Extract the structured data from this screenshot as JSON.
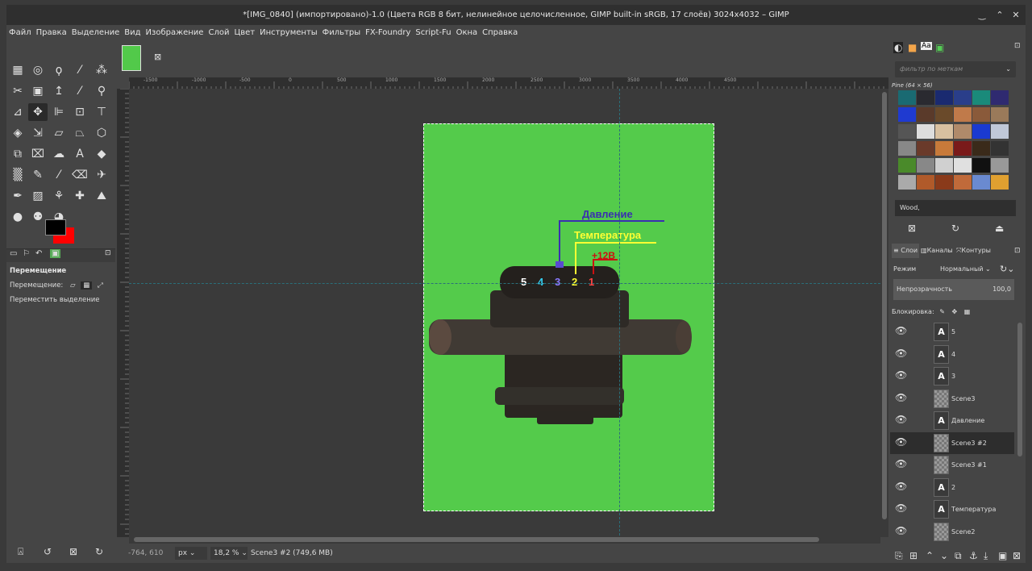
{
  "window": {
    "title": "*[IMG_0840] (импортировано)-1.0 (Цвета RGB 8 бит, нелинейное целочисленное, GIMP built-in sRGB, 17 слоёв) 3024x4032 – GIMP"
  },
  "menu": [
    "Файл",
    "Правка",
    "Выделение",
    "Вид",
    "Изображение",
    "Слой",
    "Цвет",
    "Инструменты",
    "Фильтры",
    "FX-Foundry",
    "Script-Fu",
    "Окна",
    "Справка"
  ],
  "hruler": {
    "ticks": [
      "-1500",
      "-1000",
      "-500",
      "0",
      "500",
      "1000",
      "1500",
      "2000",
      "2500",
      "3000",
      "3500",
      "4000",
      "4500"
    ]
  },
  "vruler": {
    "ticks": [
      "-1500",
      "-1000",
      "-500",
      "0",
      "500",
      "1000",
      "1500",
      "2000",
      "2500",
      "3000",
      "3500",
      "4000",
      "4500"
    ]
  },
  "tool_options": {
    "title": "Перемещение",
    "move_label": "Перемещение:",
    "option_label": "Переместить выделение"
  },
  "status": {
    "coords": "-764, 610",
    "unit": "px",
    "zoom": "18,2 %",
    "info": "Scene3 #2 (749,6 MB)"
  },
  "colors": {
    "foreground": "#000000",
    "background": "#ff0000",
    "image_bg": "#54cb4b"
  },
  "canvas_labels": {
    "pressure": "Давление",
    "temperature": "Температура",
    "power": "+12В",
    "pin5": "5",
    "pin4": "4",
    "pin3": "3",
    "pin2": "2",
    "pin1": "1"
  },
  "patterns": {
    "filter_placeholder": "фильтр по меткам",
    "set_label": "Pine (64 × 56)",
    "selected": "Wood,"
  },
  "layers_panel": {
    "tabs": [
      "Слои",
      "Каналы",
      "Контуры"
    ],
    "mode_label": "Режим",
    "mode_value": "Нормальный",
    "opacity_label": "Непрозрачность",
    "opacity_value": "100,0",
    "lock_label": "Блокировка:",
    "layers": [
      {
        "name": "5",
        "type": "text"
      },
      {
        "name": "4",
        "type": "text"
      },
      {
        "name": "3",
        "type": "text"
      },
      {
        "name": "Scene3",
        "type": "image"
      },
      {
        "name": "Давление",
        "type": "text"
      },
      {
        "name": "Scene3 #2",
        "type": "image"
      },
      {
        "name": "Scene3 #1",
        "type": "image"
      },
      {
        "name": "2",
        "type": "text"
      },
      {
        "name": "Температура",
        "type": "text"
      },
      {
        "name": "Scene2",
        "type": "image"
      }
    ]
  }
}
